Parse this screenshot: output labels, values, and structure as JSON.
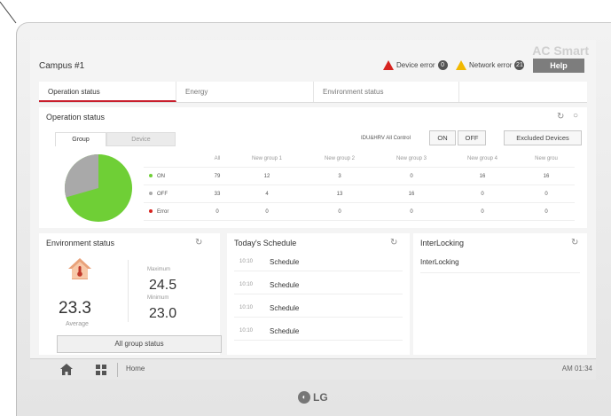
{
  "brand": "AC Smart",
  "header": {
    "campus": "Campus #1",
    "device_error_label": "Device error",
    "device_error_count": "0",
    "network_error_label": "Network error",
    "network_error_count": "21",
    "help_label": "Help"
  },
  "tabs": [
    {
      "label": "Operation status",
      "active": true
    },
    {
      "label": "Energy",
      "active": false
    },
    {
      "label": "Environment status",
      "active": false
    },
    {
      "label": "",
      "active": false
    }
  ],
  "operation": {
    "title": "Operation status",
    "subtabs": [
      "Group",
      "Device"
    ],
    "control_label": "IDU&HRV All Control",
    "on_label": "ON",
    "off_label": "OFF",
    "excluded_label": "Excluded Devices",
    "columns": [
      "",
      "All",
      "New group 1",
      "New group 2",
      "New group 3",
      "New group 4",
      "New grou"
    ],
    "rows": [
      {
        "label": "ON",
        "color": "#6fcf36",
        "values": [
          "79",
          "12",
          "3",
          "0",
          "16",
          "16"
        ]
      },
      {
        "label": "OFF",
        "color": "#aaaaaa",
        "values": [
          "33",
          "4",
          "13",
          "16",
          "0",
          "0"
        ]
      },
      {
        "label": "Error",
        "color": "#d6231f",
        "values": [
          "0",
          "0",
          "0",
          "0",
          "0",
          "0"
        ]
      }
    ],
    "pie": {
      "on": 79,
      "off": 33,
      "error": 0,
      "on_color": "#6fcf36",
      "off_color": "#a9a9a9"
    }
  },
  "environment": {
    "title": "Environment status",
    "average": "23.3",
    "average_label": "Average",
    "maximum_label": "Maximum",
    "maximum": "24.5",
    "minimum_label": "Minimum",
    "minimum": "23.0",
    "all_group_label": "All group status"
  },
  "schedule": {
    "title": "Today's Schedule",
    "items": [
      {
        "time": "10:10",
        "name": "Schedule"
      },
      {
        "time": "10:10",
        "name": "Schedule"
      },
      {
        "time": "10:10",
        "name": "Schedule"
      },
      {
        "time": "10:10",
        "name": "Schedule"
      }
    ]
  },
  "interlocking": {
    "title": "InterLocking",
    "item": "InterLocking"
  },
  "footer": {
    "home_label": "Home",
    "time": "AM 01:34"
  },
  "logo_text": "LG"
}
